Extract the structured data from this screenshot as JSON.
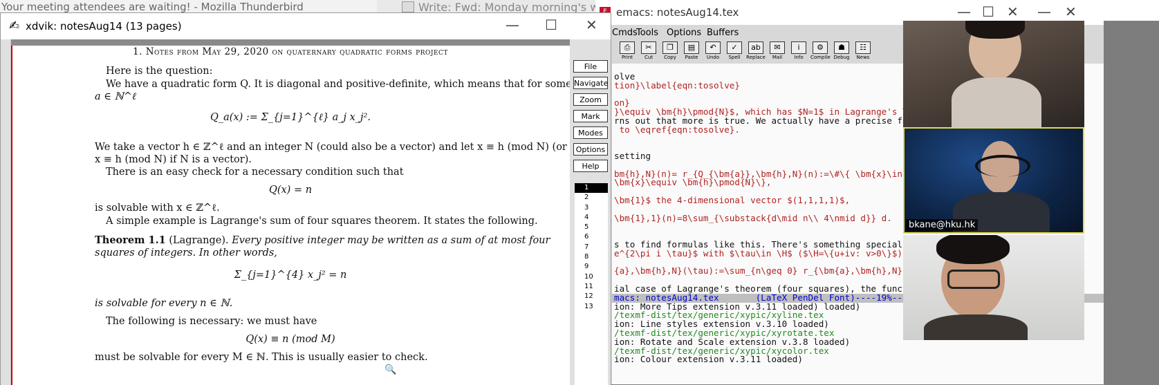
{
  "bg_windows": {
    "thunderbird_title": "Your meeting attendees are waiting! - Mozilla Thunderbird",
    "write_title": "Write: Fwd: Monday morning's whe"
  },
  "emacs": {
    "title": "emacs: notesAug14.tex",
    "menu": [
      "Cmds",
      "Tools",
      "Options",
      "Buffers"
    ],
    "toolbar": [
      "Print",
      "Cut",
      "Copy",
      "Paste",
      "Undo",
      "Spell",
      "Replace",
      "Mail",
      "Info",
      "Compile",
      "Debug",
      "News"
    ],
    "buffer_lines": [
      {
        "text": "",
        "color": "blk"
      },
      {
        "text": "olve",
        "color": "blk"
      },
      {
        "text": "tion}\\label{eqn:tosolve}",
        "color": "red"
      },
      {
        "text": "",
        "color": "blk"
      },
      {
        "text": "on}",
        "color": "red"
      },
      {
        "text": "}\\equiv \\bm{h}\\pmod{N}$, which has $N=1$ in Lagrange's T",
        "color": "red"
      },
      {
        "text": "rns out that more is true. We actually have a precise fo",
        "color": "blk"
      },
      {
        "text": " to \\eqref{eqn:tosolve}.",
        "color": "red"
      },
      {
        "text": "",
        "color": "blk"
      },
      {
        "text": "",
        "color": "blk"
      },
      {
        "text": "setting",
        "color": "blk"
      },
      {
        "text": "",
        "color": "blk"
      },
      {
        "text": "bm{h},N}(n)= r_{Q_{\\bm{a}},\\bm{h},N}(n):=\\#\\{ \\bm{x}\\in\\",
        "color": "red"
      },
      {
        "text": "\\bm{x}\\equiv \\bm{h}\\pmod{N}\\},",
        "color": "red"
      },
      {
        "text": "",
        "color": "blk"
      },
      {
        "text": "\\bm{1}$ the 4-dimensional vector $(1,1,1,1)$,",
        "color": "red"
      },
      {
        "text": "",
        "color": "blk"
      },
      {
        "text": "\\bm{1},1}(n)=8\\sum_{\\substack{d\\mid n\\\\ 4\\nmid d}} d.",
        "color": "red"
      },
      {
        "text": "",
        "color": "blk"
      },
      {
        "text": "",
        "color": "blk"
      },
      {
        "text": "s to find formulas like this. There's something special",
        "color": "blk"
      },
      {
        "text": "e^{2\\pi i \\tau}$ with $\\tau\\in \\H$ ($\\H=\\{u+iv: v>0\\}$)",
        "color": "red"
      },
      {
        "text": "",
        "color": "blk"
      },
      {
        "text": "{a},\\bm{h},N}(\\tau):=\\sum_{n\\geq 0} r_{\\bm{a},\\bm{h},N}(",
        "color": "red"
      },
      {
        "text": "",
        "color": "blk"
      },
      {
        "text": "ial case of Lagrange's theorem (four squares), the funct",
        "color": "blk"
      },
      {
        "text": "macs: notesAug14.tex       (LaTeX PenDel Font)----19%----",
        "color": "mode"
      },
      {
        "text": "ion: More Tips extension v.3.11 loaded) loaded)",
        "color": "blk"
      },
      {
        "text": "/texmf-dist/tex/generic/xypic/xyline.tex",
        "color": "grn"
      },
      {
        "text": "ion: Line styles extension v.3.10 loaded)",
        "color": "blk"
      },
      {
        "text": "/texmf-dist/tex/generic/xypic/xyrotate.tex",
        "color": "grn"
      },
      {
        "text": "ion: Rotate and Scale extension v.3.8 loaded)",
        "color": "blk"
      },
      {
        "text": "/texmf-dist/tex/generic/xypic/xycolor.tex",
        "color": "grn"
      },
      {
        "text": "ion: Colour extension v.3.11 loaded)",
        "color": "blk"
      }
    ]
  },
  "xdvik": {
    "title": "xdvik:  notesAug14   (13 pages)",
    "buttons": [
      "File",
      "Navigate",
      "Zoom",
      "Mark",
      "Modes",
      "Options",
      "Help"
    ],
    "pages": [
      "1",
      "2",
      "3",
      "4",
      "5",
      "6",
      "7",
      "8",
      "9",
      "10",
      "11",
      "12",
      "13"
    ],
    "selected_page": "1",
    "doc": {
      "heading": "1. Notes from May 29, 2020 on quaternary quadratic forms project",
      "p1": "Here is the question:",
      "p2a": "We have a quadratic form Q. It is diagonal and positive-definite, which means that for some",
      "p2b": "a ∈ ℕ^ℓ",
      "eq1": "Q_a(x) := Σ_{j=1}^{ℓ} a_j x_j².",
      "p3a": "We take a vector h ∈ ℤ^ℓ and an integer N (could also be a vector) and let x ≡ h (mod N) (or",
      "p3b": "x ≡ h (mod N) if N is a vector).",
      "p4": "There is an easy check for a necessary condition such that",
      "eq2": "Q(x) = n",
      "p5": "is solvable with x ∈ ℤ^ℓ.",
      "p6": "A simple example is Lagrange's sum of four squares theorem. It states the following.",
      "thm_label": "Theorem 1.1",
      "thm_name": "(Lagrange).",
      "thm_a": "Every positive integer may be written as a sum of at most four",
      "thm_b": "squares of integers. In other words,",
      "eq3": "Σ_{j=1}^{4} x_j² = n",
      "thm_c": "is solvable for every n ∈ ℕ.",
      "p7": "The following is necessary: we must have",
      "eq4": "Q(x) ≡ n   (mod M)",
      "p8": "must be solvable for every M ∈ ℕ. This is usually easier to check."
    }
  },
  "zoom": {
    "active_speaker_name": "bkane@hku.hk"
  }
}
